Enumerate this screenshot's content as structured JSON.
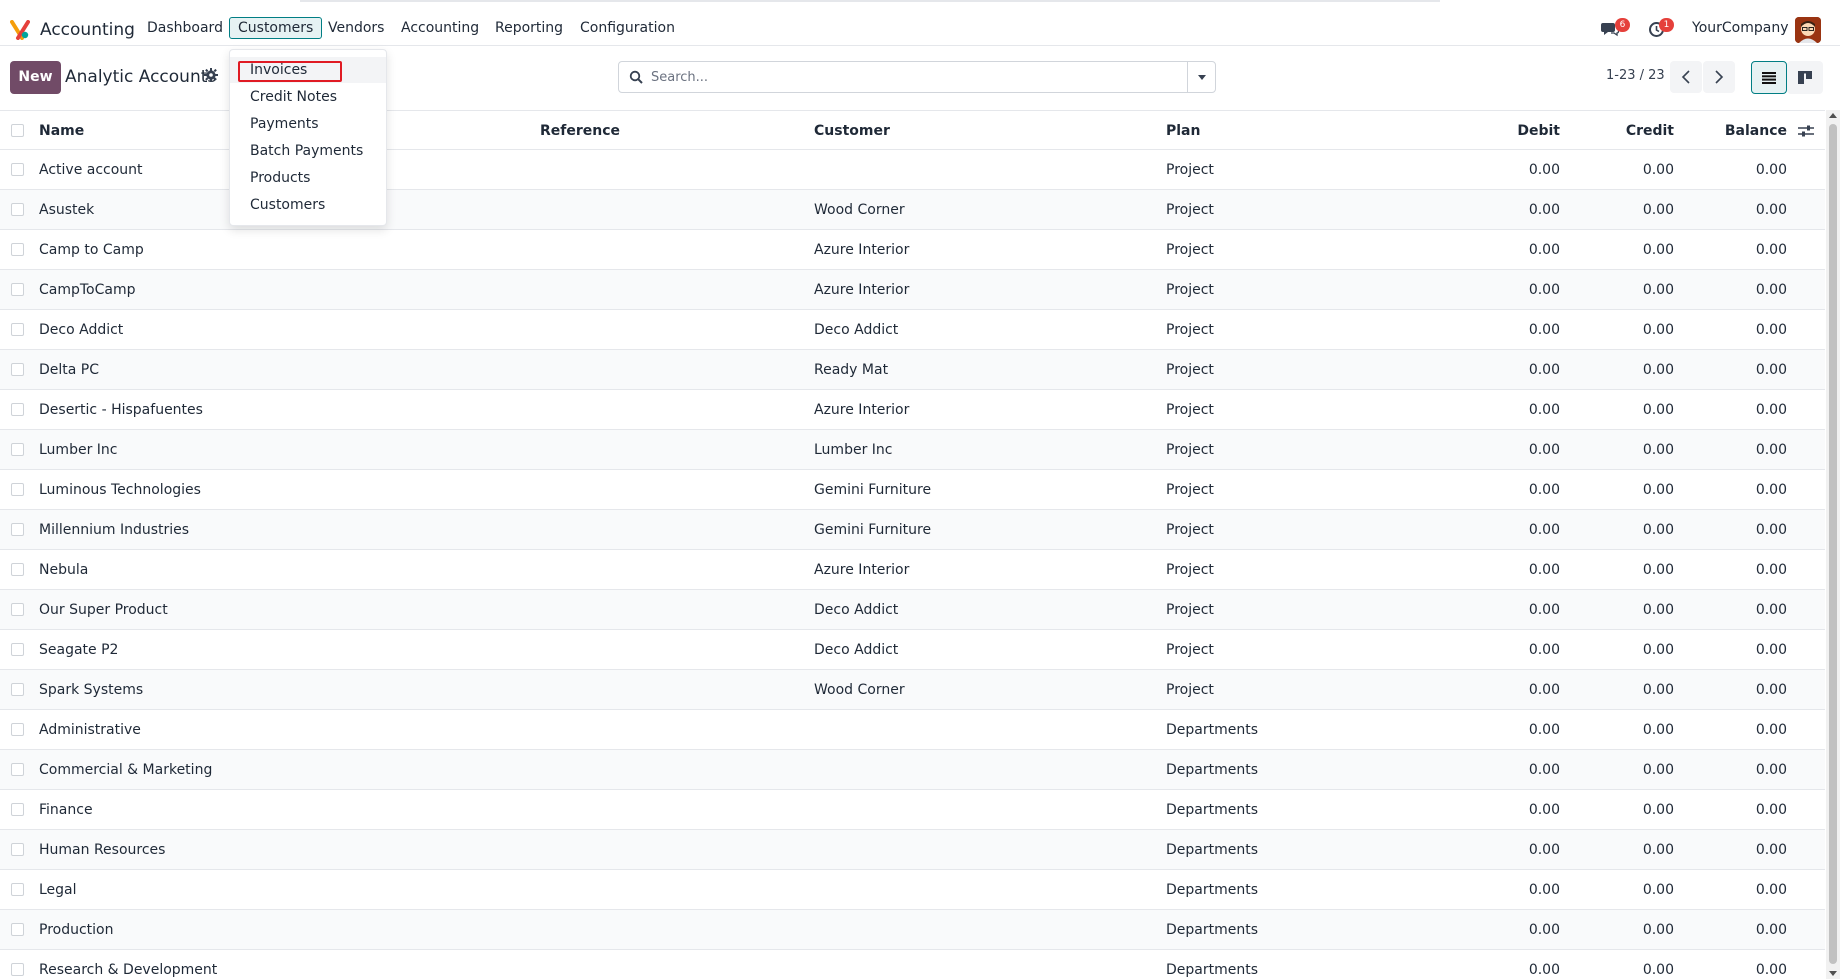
{
  "navbar": {
    "app_name": "Accounting",
    "menu": [
      "Dashboard",
      "Customers",
      "Vendors",
      "Accounting",
      "Reporting",
      "Configuration"
    ],
    "active_menu": "Customers",
    "messages_badge": "6",
    "activities_badge": "1",
    "company": "YourCompany"
  },
  "control": {
    "new_label": "New",
    "title": "Analytic Accounts",
    "search_placeholder": "Search...",
    "pager": "1-23 / 23"
  },
  "dropdown": {
    "items": [
      "Invoices",
      "Credit Notes",
      "Payments",
      "Batch Payments",
      "Products",
      "Customers"
    ],
    "highlighted": "Invoices"
  },
  "table": {
    "headers": {
      "name": "Name",
      "reference": "Reference",
      "customer": "Customer",
      "plan": "Plan",
      "debit": "Debit",
      "credit": "Credit",
      "balance": "Balance"
    },
    "rows": [
      {
        "name": "Active account",
        "customer": "",
        "plan": "Project",
        "debit": "0.00",
        "credit": "0.00",
        "balance": "0.00"
      },
      {
        "name": "Asustek",
        "customer": "Wood Corner",
        "plan": "Project",
        "debit": "0.00",
        "credit": "0.00",
        "balance": "0.00"
      },
      {
        "name": "Camp to Camp",
        "customer": "Azure Interior",
        "plan": "Project",
        "debit": "0.00",
        "credit": "0.00",
        "balance": "0.00"
      },
      {
        "name": "CampToCamp",
        "customer": "Azure Interior",
        "plan": "Project",
        "debit": "0.00",
        "credit": "0.00",
        "balance": "0.00"
      },
      {
        "name": "Deco Addict",
        "customer": "Deco Addict",
        "plan": "Project",
        "debit": "0.00",
        "credit": "0.00",
        "balance": "0.00"
      },
      {
        "name": "Delta PC",
        "customer": "Ready Mat",
        "plan": "Project",
        "debit": "0.00",
        "credit": "0.00",
        "balance": "0.00"
      },
      {
        "name": "Desertic - Hispafuentes",
        "customer": "Azure Interior",
        "plan": "Project",
        "debit": "0.00",
        "credit": "0.00",
        "balance": "0.00"
      },
      {
        "name": "Lumber Inc",
        "customer": "Lumber Inc",
        "plan": "Project",
        "debit": "0.00",
        "credit": "0.00",
        "balance": "0.00"
      },
      {
        "name": "Luminous Technologies",
        "customer": "Gemini Furniture",
        "plan": "Project",
        "debit": "0.00",
        "credit": "0.00",
        "balance": "0.00"
      },
      {
        "name": "Millennium Industries",
        "customer": "Gemini Furniture",
        "plan": "Project",
        "debit": "0.00",
        "credit": "0.00",
        "balance": "0.00"
      },
      {
        "name": "Nebula",
        "customer": "Azure Interior",
        "plan": "Project",
        "debit": "0.00",
        "credit": "0.00",
        "balance": "0.00"
      },
      {
        "name": "Our Super Product",
        "customer": "Deco Addict",
        "plan": "Project",
        "debit": "0.00",
        "credit": "0.00",
        "balance": "0.00"
      },
      {
        "name": "Seagate P2",
        "customer": "Deco Addict",
        "plan": "Project",
        "debit": "0.00",
        "credit": "0.00",
        "balance": "0.00"
      },
      {
        "name": "Spark Systems",
        "customer": "Wood Corner",
        "plan": "Project",
        "debit": "0.00",
        "credit": "0.00",
        "balance": "0.00"
      },
      {
        "name": "Administrative",
        "customer": "",
        "plan": "Departments",
        "debit": "0.00",
        "credit": "0.00",
        "balance": "0.00"
      },
      {
        "name": "Commercial & Marketing",
        "customer": "",
        "plan": "Departments",
        "debit": "0.00",
        "credit": "0.00",
        "balance": "0.00"
      },
      {
        "name": "Finance",
        "customer": "",
        "plan": "Departments",
        "debit": "0.00",
        "credit": "0.00",
        "balance": "0.00"
      },
      {
        "name": "Human Resources",
        "customer": "",
        "plan": "Departments",
        "debit": "0.00",
        "credit": "0.00",
        "balance": "0.00"
      },
      {
        "name": "Legal",
        "customer": "",
        "plan": "Departments",
        "debit": "0.00",
        "credit": "0.00",
        "balance": "0.00"
      },
      {
        "name": "Production",
        "customer": "",
        "plan": "Departments",
        "debit": "0.00",
        "credit": "0.00",
        "balance": "0.00"
      },
      {
        "name": "Research & Development",
        "customer": "",
        "plan": "Departments",
        "debit": "0.00",
        "credit": "0.00",
        "balance": "0.00"
      }
    ]
  },
  "colors": {
    "brand": "#714b67",
    "accent": "#017e84",
    "badge": "#e5403b",
    "highlight": "#e01b24"
  }
}
